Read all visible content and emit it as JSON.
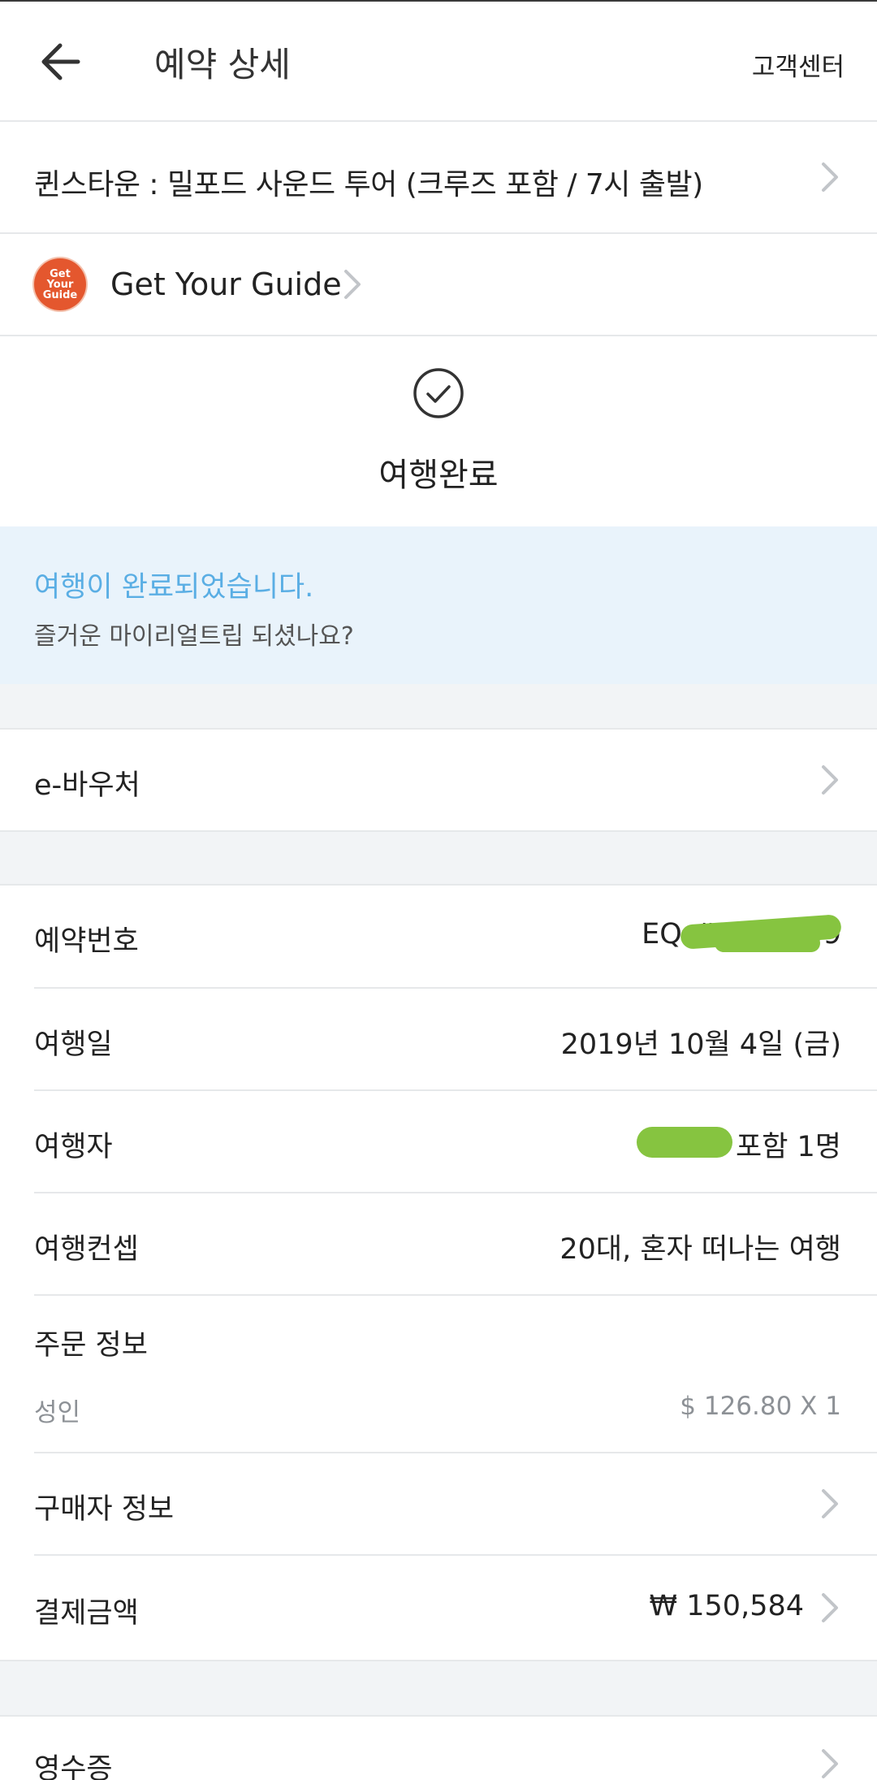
{
  "header": {
    "title": "예약 상세",
    "support_label": "고객센터"
  },
  "product": {
    "name": "퀸스타운 : 밀포드 사운드 투어 (크루즈 포함 / 7시 출발)"
  },
  "provider": {
    "logo_text": [
      "Get",
      "Your",
      "Guide"
    ],
    "name": "Get Your Guide"
  },
  "status": {
    "label": "여행완료"
  },
  "banner": {
    "title": "여행이 완료되었습니다.",
    "subtitle": "즐거운 마이리얼트립 되셨나요?"
  },
  "voucher": {
    "label": "e-바우처"
  },
  "details": {
    "booking_number_label": "예약번호",
    "booking_number_value": "EQ-##-19659",
    "travel_date_label": "여행일",
    "travel_date_value": "2019년 10월 4일 (금)",
    "traveler_label": "여행자",
    "traveler_value": "포함 1명",
    "concept_label": "여행컨셉",
    "concept_value": "20대, 혼자 떠나는 여행"
  },
  "order": {
    "title": "주문 정보",
    "item_label": "성인",
    "item_price": "$ 126.80 X 1"
  },
  "buyer": {
    "label": "구매자 정보"
  },
  "payment": {
    "label": "결제금액",
    "value": "₩ 150,584"
  },
  "receipt": {
    "label": "영수증"
  },
  "colors": {
    "accent": "#5aaee4",
    "banner_bg": "#e9f3fb",
    "redaction": "#86c440",
    "logo": "#e4572e"
  }
}
